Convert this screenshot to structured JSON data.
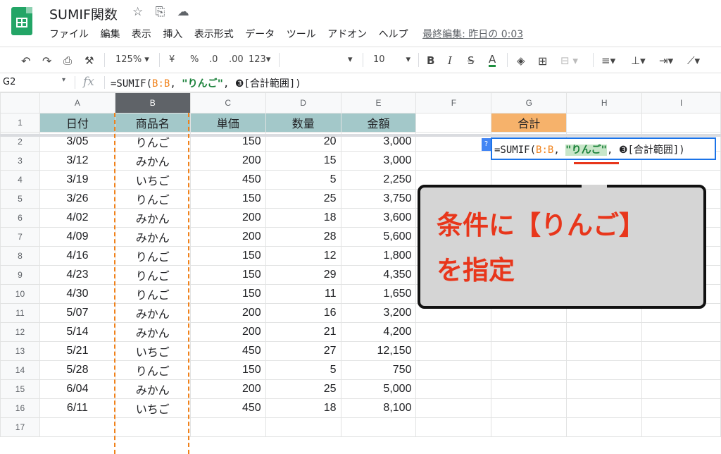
{
  "app": {
    "doc_title": "SUMIF関数",
    "menu": [
      "ファイル",
      "編集",
      "表示",
      "挿入",
      "表示形式",
      "データ",
      "ツール",
      "アドオン",
      "ヘルプ"
    ],
    "last_edit": "最終編集: 昨日の 0:03"
  },
  "toolbar": {
    "zoom": "125%",
    "currency": "¥",
    "percent": "%",
    "dec_decrease": ".0",
    "dec_increase": ".00",
    "format_more": "123",
    "font_size": "10"
  },
  "formula_bar": {
    "name_box": "G2",
    "fx": "fx",
    "formula_prefix": "=SUMIF(",
    "formula_range": "B:B",
    "formula_sep1": ", ",
    "formula_criterion": "\"りんご\"",
    "formula_rest": ", ❸[合計範囲])"
  },
  "columns": [
    "A",
    "B",
    "C",
    "D",
    "E",
    "F",
    "G",
    "H",
    "I"
  ],
  "headers": {
    "A": "日付",
    "B": "商品名",
    "C": "単価",
    "D": "数量",
    "E": "金額",
    "G": "合計"
  },
  "rows": [
    {
      "n": "2",
      "date": "3/05",
      "item": "りんご",
      "price": "150",
      "qty": "20",
      "amount": "3,000"
    },
    {
      "n": "3",
      "date": "3/12",
      "item": "みかん",
      "price": "200",
      "qty": "15",
      "amount": "3,000"
    },
    {
      "n": "4",
      "date": "3/19",
      "item": "いちご",
      "price": "450",
      "qty": "5",
      "amount": "2,250"
    },
    {
      "n": "5",
      "date": "3/26",
      "item": "りんご",
      "price": "150",
      "qty": "25",
      "amount": "3,750"
    },
    {
      "n": "6",
      "date": "4/02",
      "item": "みかん",
      "price": "200",
      "qty": "18",
      "amount": "3,600"
    },
    {
      "n": "7",
      "date": "4/09",
      "item": "みかん",
      "price": "200",
      "qty": "28",
      "amount": "5,600"
    },
    {
      "n": "8",
      "date": "4/16",
      "item": "りんご",
      "price": "150",
      "qty": "12",
      "amount": "1,800"
    },
    {
      "n": "9",
      "date": "4/23",
      "item": "りんご",
      "price": "150",
      "qty": "29",
      "amount": "4,350"
    },
    {
      "n": "10",
      "date": "4/30",
      "item": "りんご",
      "price": "150",
      "qty": "11",
      "amount": "1,650"
    },
    {
      "n": "11",
      "date": "5/07",
      "item": "みかん",
      "price": "200",
      "qty": "16",
      "amount": "3,200"
    },
    {
      "n": "12",
      "date": "5/14",
      "item": "みかん",
      "price": "200",
      "qty": "21",
      "amount": "4,200"
    },
    {
      "n": "13",
      "date": "5/21",
      "item": "いちご",
      "price": "450",
      "qty": "27",
      "amount": "12,150"
    },
    {
      "n": "14",
      "date": "5/28",
      "item": "りんご",
      "price": "150",
      "qty": "5",
      "amount": "750"
    },
    {
      "n": "15",
      "date": "6/04",
      "item": "みかん",
      "price": "200",
      "qty": "25",
      "amount": "5,000"
    },
    {
      "n": "16",
      "date": "6/11",
      "item": "いちご",
      "price": "450",
      "qty": "18",
      "amount": "8,100"
    }
  ],
  "empty_row": "17",
  "header_row_number": "1",
  "editor": {
    "prefix": "=SUMIF(",
    "range": "B:B",
    "sep": ", ",
    "criterion": "\"りんご\"",
    "rest": ", ❸[合計範囲])",
    "help": "?"
  },
  "callout": {
    "line1": "条件に【りんご】",
    "line2": "を指定"
  },
  "colors": {
    "header_fill": "#a3c8c9",
    "sum_header_fill": "#f6b26b",
    "callout_text": "#e8361b",
    "range_highlight": "#f0811a",
    "criterion": "#188038"
  }
}
